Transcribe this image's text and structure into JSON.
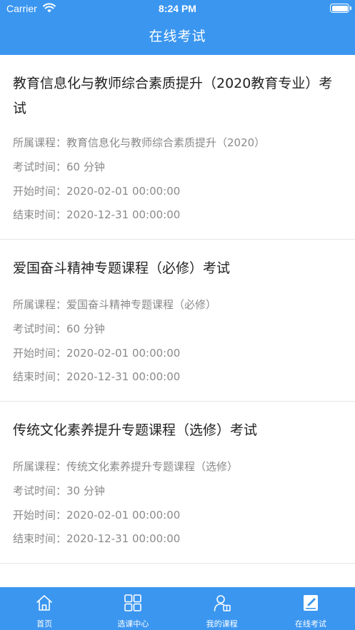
{
  "status_bar": {
    "carrier": "Carrier",
    "time": "8:24 PM"
  },
  "nav": {
    "title": "在线考试"
  },
  "exams": [
    {
      "title": "教育信息化与教师综合素质提升（2020教育专业）考试",
      "course": "所属课程：教育信息化与教师综合素质提升（2020）",
      "duration": "考试时间：60 分钟",
      "start": "开始时间：2020-02-01 00:00:00",
      "end": "结束时间：2020-12-31 00:00:00"
    },
    {
      "title": "爱国奋斗精神专题课程（必修）考试",
      "course": "所属课程：爱国奋斗精神专题课程（必修）",
      "duration": "考试时间：60 分钟",
      "start": "开始时间：2020-02-01 00:00:00",
      "end": "结束时间：2020-12-31 00:00:00"
    },
    {
      "title": "传统文化素养提升专题课程（选修）考试",
      "course": "所属课程：传统文化素养提升专题课程（选修）",
      "duration": "考试时间：30 分钟",
      "start": "开始时间：2020-02-01 00:00:00",
      "end": "结束时间：2020-12-31 00:00:00"
    }
  ],
  "tabbar": {
    "items": [
      {
        "label": "首页",
        "icon": "home-icon"
      },
      {
        "label": "选课中心",
        "icon": "grid-icon"
      },
      {
        "label": "我的课程",
        "icon": "user-book-icon"
      },
      {
        "label": "在线考试",
        "icon": "exam-icon",
        "active": true
      }
    ]
  },
  "colors": {
    "brand": "#3b96f0",
    "text": "#222222",
    "muted": "#8a8a8a"
  }
}
